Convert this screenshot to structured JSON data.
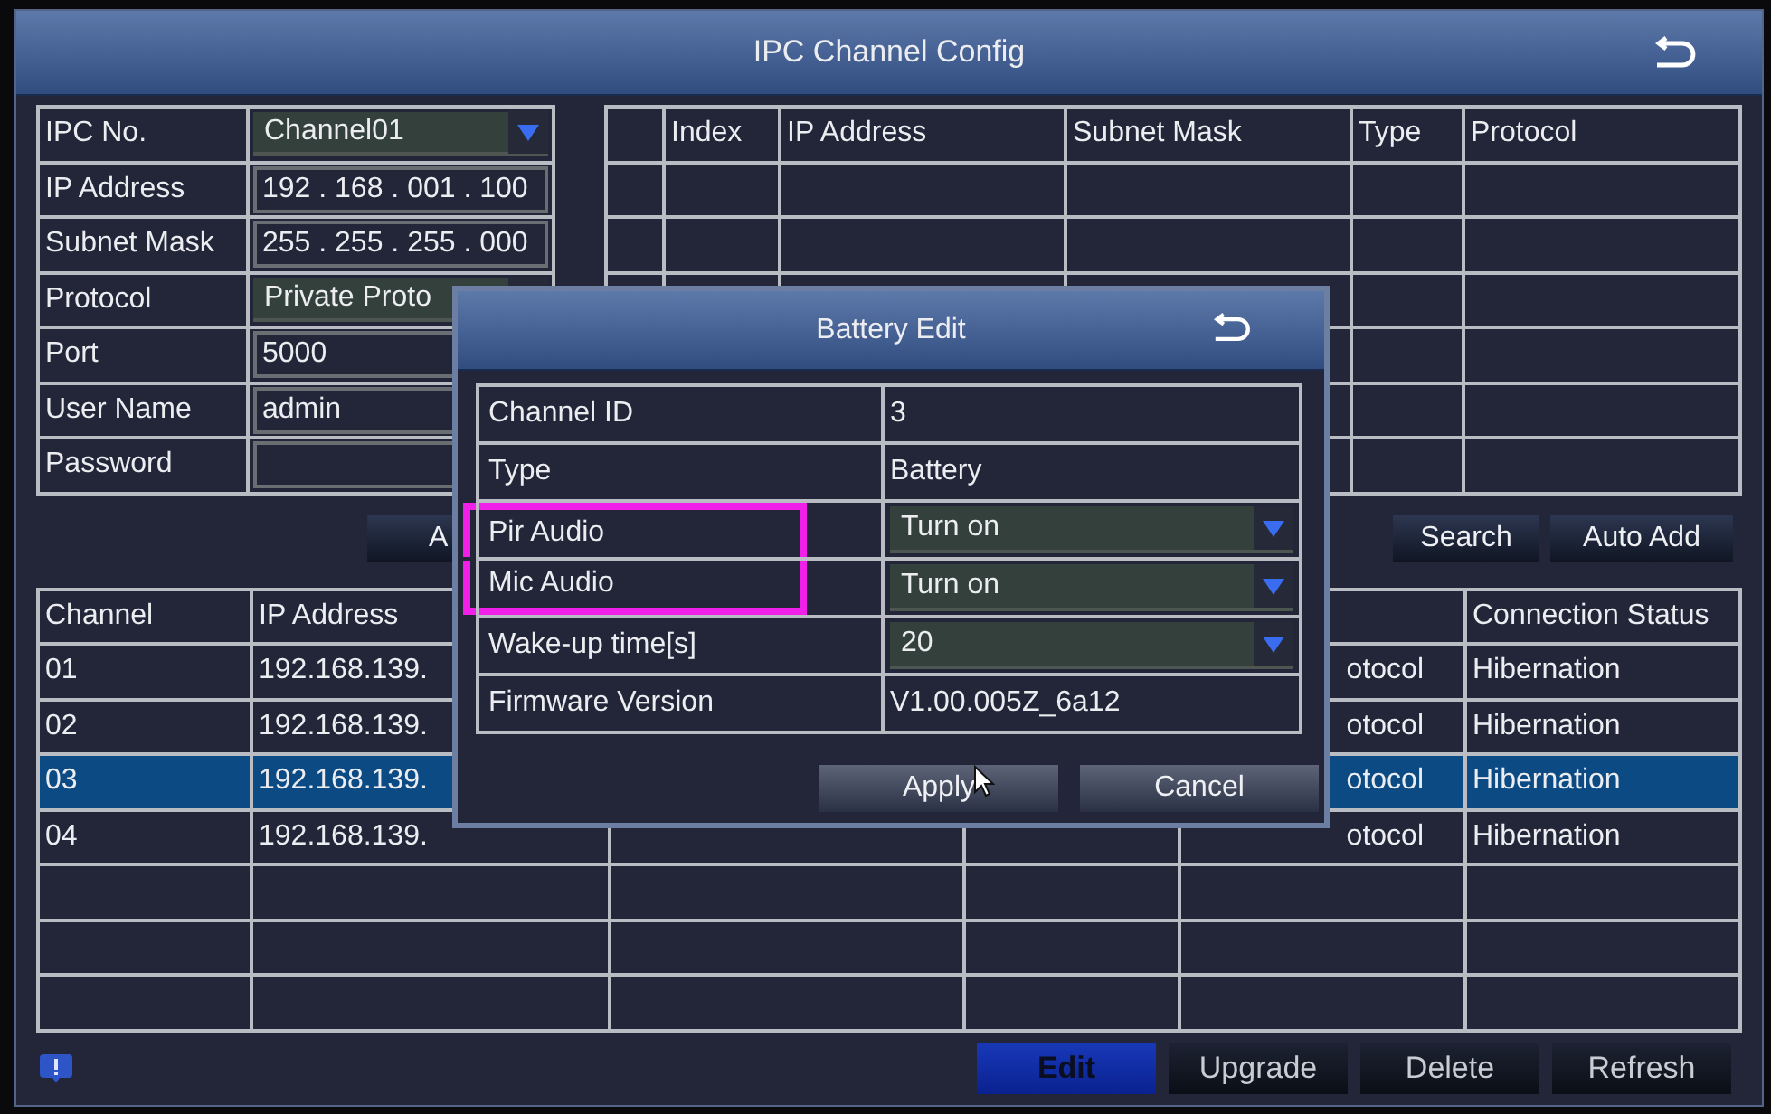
{
  "window": {
    "title": "IPC Channel Config"
  },
  "ipc_form": {
    "rows": [
      {
        "label": "IPC No.",
        "kind": "dropdown",
        "value": "Channel01"
      },
      {
        "label": "IP Address",
        "kind": "input",
        "value": "192 . 168 . 001 . 100"
      },
      {
        "label": "Subnet Mask",
        "kind": "input",
        "value": "255 . 255 . 255 . 000"
      },
      {
        "label": "Protocol",
        "kind": "dropdown",
        "value": "Private Proto"
      },
      {
        "label": "Port",
        "kind": "input",
        "value": "5000"
      },
      {
        "label": "User Name",
        "kind": "input",
        "value": "admin"
      },
      {
        "label": "Password",
        "kind": "input"
      }
    ]
  },
  "search_table": {
    "columns": [
      "Index",
      "IP Address",
      "Subnet Mask",
      "Type",
      "Protocol"
    ]
  },
  "form_buttons": [
    {
      "label": "A"
    },
    {
      "label": "Search"
    },
    {
      "label": "Auto Add"
    }
  ],
  "channel_table": {
    "columns": {
      "channel": "Channel",
      "ip_address": "IP Address",
      "connection_status": "Connection Status"
    },
    "rows": [
      {
        "channel": "01",
        "ip_address": "192.168.139.",
        "protocol": "otocol",
        "connection_status": "Hibernation",
        "selected": false
      },
      {
        "channel": "02",
        "ip_address": "192.168.139.",
        "protocol": "otocol",
        "connection_status": "Hibernation",
        "selected": false
      },
      {
        "channel": "03",
        "ip_address": "192.168.139.",
        "protocol": "otocol",
        "connection_status": "Hibernation",
        "selected": true
      },
      {
        "channel": "04",
        "ip_address": "192.168.139.",
        "protocol": "otocol",
        "connection_status": "Hibernation",
        "selected": false
      }
    ]
  },
  "bottom_buttons": [
    {
      "label": "Edit",
      "selected": true
    },
    {
      "label": "Upgrade",
      "selected": false
    },
    {
      "label": "Delete",
      "selected": false
    },
    {
      "label": "Refresh",
      "selected": false
    }
  ],
  "dialog": {
    "title": "Battery Edit",
    "fields": [
      {
        "label": "Channel ID",
        "kind": "text",
        "value": "3",
        "highlighted": false
      },
      {
        "label": "Type",
        "kind": "text",
        "value": "Battery",
        "highlighted": false
      },
      {
        "label": "Pir Audio",
        "kind": "dropdown",
        "value": "Turn on",
        "highlighted": true
      },
      {
        "label": "Mic Audio",
        "kind": "dropdown",
        "value": "Turn on",
        "highlighted": true
      },
      {
        "label": "Wake-up time[s]",
        "kind": "dropdown",
        "value": "20",
        "highlighted": false
      },
      {
        "label": "Firmware Version",
        "kind": "text",
        "value": "V1.00.005Z_6a12",
        "highlighted": false
      }
    ],
    "buttons": [
      {
        "label": "Apply"
      },
      {
        "label": "Cancel"
      }
    ]
  }
}
